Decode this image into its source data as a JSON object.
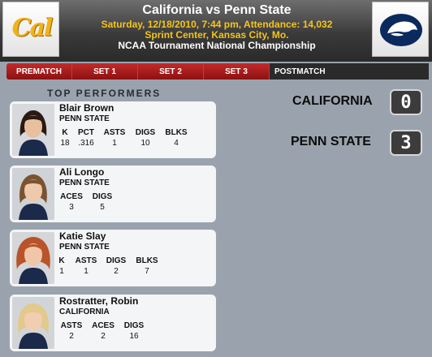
{
  "header": {
    "title": "California vs Penn State",
    "line1": "Saturday, 12/18/2010, 7:44 pm, Attendance: 14,032",
    "line2": "Sprint Center, Kansas City, Mo.",
    "line3": "NCAA Tournament National Championship",
    "left_logo_text": "Cal",
    "right_logo": "nittany-lion-icon"
  },
  "tabs": [
    {
      "label": "PREMATCH"
    },
    {
      "label": "SET 1"
    },
    {
      "label": "SET 2"
    },
    {
      "label": "SET 3"
    },
    {
      "label": "POSTMATCH",
      "active": true
    }
  ],
  "section_title": "TOP PERFORMERS",
  "performers": [
    {
      "name": "Blair Brown",
      "team": "PENN STATE",
      "stats": [
        {
          "label": "K",
          "value": "18"
        },
        {
          "label": "PCT",
          "value": ".316"
        },
        {
          "label": "ASTS",
          "value": "1"
        },
        {
          "label": "DIGS",
          "value": "10"
        },
        {
          "label": "BLKS",
          "value": "4"
        }
      ]
    },
    {
      "name": "Ali Longo",
      "team": "PENN STATE",
      "stats": [
        {
          "label": "ACES",
          "value": "3"
        },
        {
          "label": "DIGS",
          "value": "5"
        }
      ]
    },
    {
      "name": "Katie Slay",
      "team": "PENN STATE",
      "stats": [
        {
          "label": "K",
          "value": "1"
        },
        {
          "label": "ASTS",
          "value": "1"
        },
        {
          "label": "DIGS",
          "value": "2"
        },
        {
          "label": "BLKS",
          "value": "7"
        }
      ]
    },
    {
      "name": "Rostratter, Robin",
      "team": "CALIFORNIA",
      "stats": [
        {
          "label": "ASTS",
          "value": "2"
        },
        {
          "label": "ACES",
          "value": "2"
        },
        {
          "label": "DIGS",
          "value": "16"
        }
      ]
    }
  ],
  "scores": [
    {
      "team": "CALIFORNIA",
      "score": "0"
    },
    {
      "team": "PENN STATE",
      "score": "3"
    }
  ],
  "colors": {
    "tab_red": "#b01e1e",
    "header_yellow": "#f5c518",
    "cal_gold": "#f2b21a",
    "psu_navy": "#0a2a5e"
  }
}
